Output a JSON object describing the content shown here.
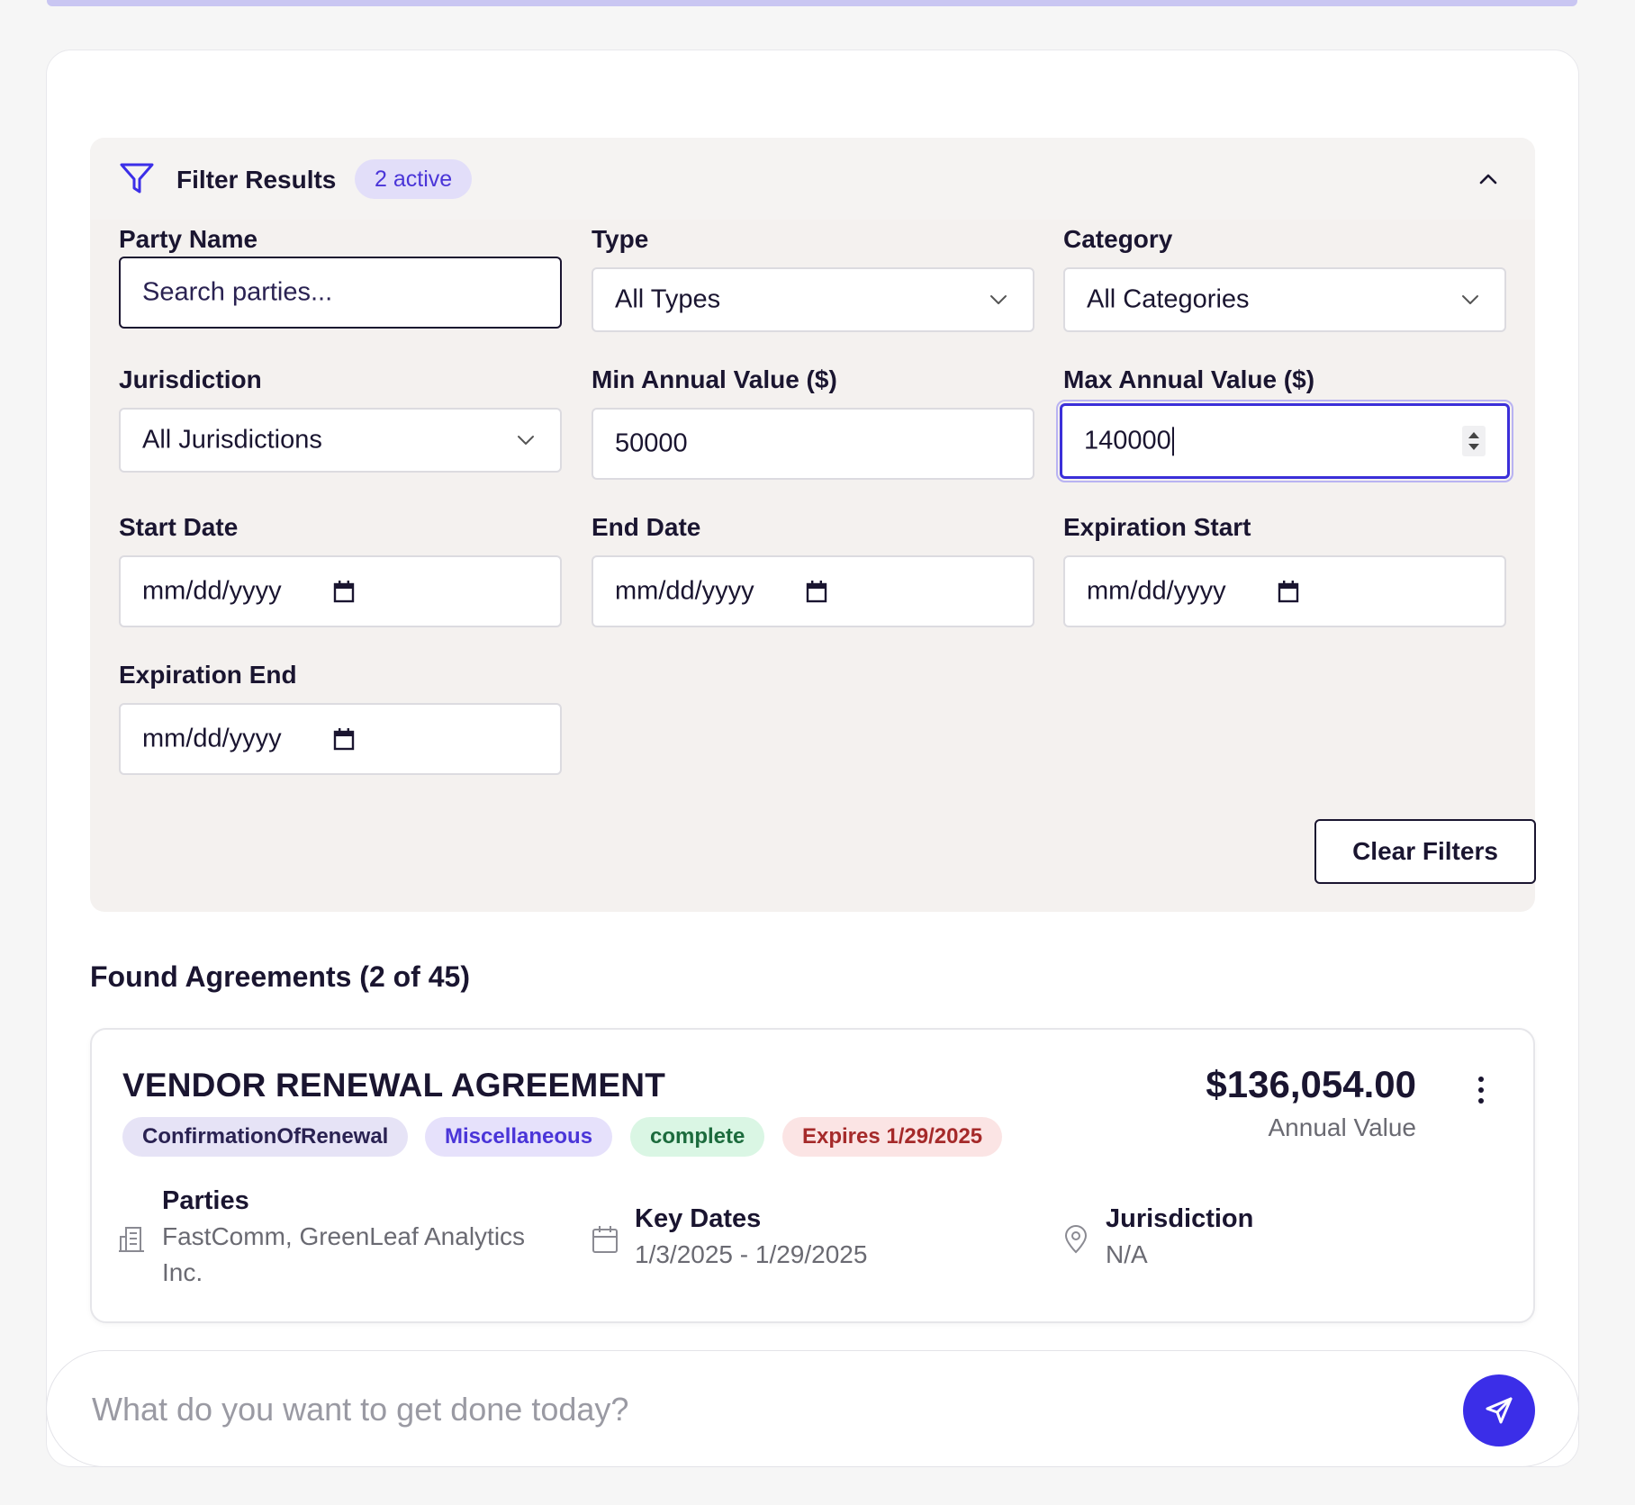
{
  "filter": {
    "title": "Filter Results",
    "active_badge": "2 active",
    "fields": {
      "party_name": {
        "label": "Party Name",
        "placeholder": "Search parties..."
      },
      "type": {
        "label": "Type",
        "value": "All Types"
      },
      "category": {
        "label": "Category",
        "value": "All Categories"
      },
      "jurisdiction": {
        "label": "Jurisdiction",
        "value": "All Jurisdictions"
      },
      "min_value": {
        "label": "Min Annual Value ($)",
        "value": "50000"
      },
      "max_value": {
        "label": "Max Annual Value ($)",
        "value": "140000"
      },
      "start_date": {
        "label": "Start Date",
        "placeholder": "mm/dd/yyyy"
      },
      "end_date": {
        "label": "End Date",
        "placeholder": "mm/dd/yyyy"
      },
      "expiration_start": {
        "label": "Expiration Start",
        "placeholder": "mm/dd/yyyy"
      },
      "expiration_end": {
        "label": "Expiration End",
        "placeholder": "mm/dd/yyyy"
      }
    },
    "clear_label": "Clear Filters"
  },
  "results": {
    "heading": "Found Agreements (2 of 45)",
    "items": [
      {
        "title": "VENDOR RENEWAL AGREEMENT",
        "tags": {
          "type": "ConfirmationOfRenewal",
          "category": "Miscellaneous",
          "status": "complete",
          "expires": "Expires 1/29/2025"
        },
        "amount": "$136,054.00",
        "amount_label": "Annual Value",
        "parties_label": "Parties",
        "parties_line1": "FastComm, GreenLeaf Analytics",
        "parties_line2": "Inc.",
        "dates_label": "Key Dates",
        "dates_value": "1/3/2025 - 1/29/2025",
        "jurisdiction_label": "Jurisdiction",
        "jurisdiction_value": "N/A"
      }
    ]
  },
  "chat": {
    "placeholder": "What do you want to get done today?"
  },
  "colors": {
    "accent": "#3b2ee8",
    "panel_bg": "#f4f1ef",
    "text": "#1a1530"
  },
  "icons": {
    "filter": "filter-funnel-icon",
    "collapse": "chevron-up-icon",
    "dropdown": "chevron-down-icon",
    "calendar": "calendar-icon",
    "building": "building-icon",
    "location": "map-pin-icon",
    "more": "kebab-menu-icon",
    "send": "send-arrow-icon"
  }
}
